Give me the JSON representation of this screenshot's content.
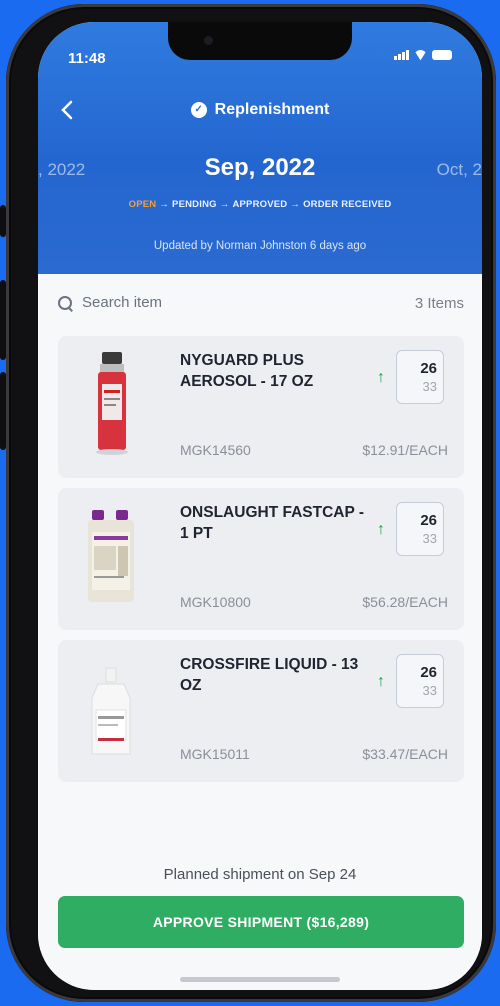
{
  "status_bar": {
    "time": "11:48"
  },
  "nav": {
    "back_icon": "chevron-left-icon",
    "title_icon": "replenishment-icon",
    "title": "Replenishment"
  },
  "month": {
    "prev": ", 2022",
    "current": "Sep, 2022",
    "next": "Oct, 2"
  },
  "stages": {
    "open": "OPEN",
    "pending": "PENDING",
    "approved": "APPROVED",
    "received": "ORDER RECEIVED",
    "separator": "→"
  },
  "updated_text": "Updated by Norman Johnston 6 days ago",
  "search": {
    "placeholder": "Search item",
    "icon": "search-icon"
  },
  "item_count": "3 Items",
  "items": [
    {
      "name": "NYGUARD PLUS AEROSOL - 17 OZ",
      "qty": "26",
      "max": "33",
      "sku": "MGK14560",
      "price": "$12.91/EACH",
      "trend": "↑"
    },
    {
      "name": "ONSLAUGHT FASTCAP - 1 PT",
      "qty": "26",
      "max": "33",
      "sku": "MGK10800",
      "price": "$56.28/EACH",
      "trend": "↑"
    },
    {
      "name": "CROSSFIRE LIQUID - 13 OZ",
      "qty": "26",
      "max": "33",
      "sku": "MGK15011",
      "price": "$33.47/EACH",
      "trend": "↑"
    }
  ],
  "shipment_note": "Planned shipment on Sep 24",
  "approve_button": "APPROVE SHIPMENT ($16,289)",
  "colors": {
    "background": "#1a6bf0",
    "header": "#2a6dd5",
    "open_stage": "#f2a13a",
    "approve": "#2fae63",
    "trend_up": "#1aa34f"
  }
}
